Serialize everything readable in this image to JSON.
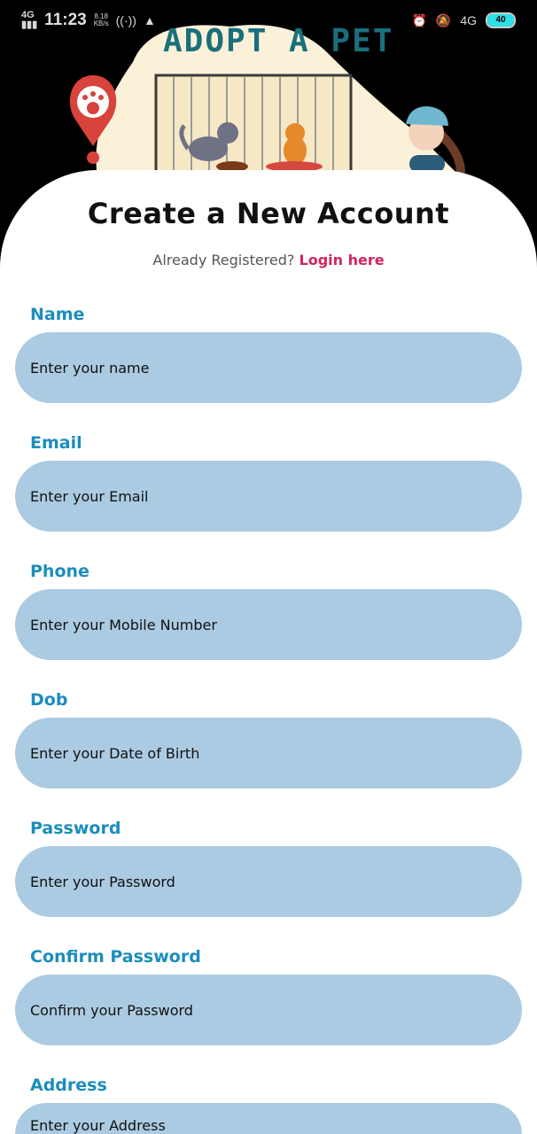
{
  "status_bar": {
    "network_left": "4G",
    "time": "11:23",
    "speed_value": "8.18",
    "speed_unit": "KB/s",
    "network_right": "4G",
    "battery": "40"
  },
  "banner": {
    "title": "ADOPT A PET"
  },
  "form": {
    "title": "Create a New Account",
    "already_text": "Already Registered?",
    "login_link": "Login here",
    "fields": [
      {
        "label": "Name",
        "placeholder": "Enter your name"
      },
      {
        "label": "Email",
        "placeholder": "Enter your Email"
      },
      {
        "label": "Phone",
        "placeholder": "Enter your Mobile Number"
      },
      {
        "label": "Dob",
        "placeholder": "Enter your Date of Birth"
      },
      {
        "label": "Password",
        "placeholder": "Enter your Password"
      },
      {
        "label": "Confirm Password",
        "placeholder": "Confirm your Password"
      },
      {
        "label": "Address",
        "placeholder": "Enter your Address"
      }
    ]
  },
  "colors": {
    "accent": "#1c8dbd",
    "link": "#d2245f",
    "input_bg": "#abcbe2"
  }
}
